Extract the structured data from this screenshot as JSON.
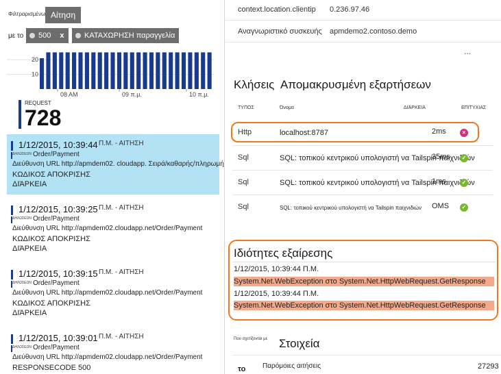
{
  "filter": {
    "label": "Φιλτραρισμένων",
    "type_chip": "Αίτηση",
    "with_label": "με το",
    "chips": [
      {
        "label": "500",
        "close": "x"
      },
      {
        "label": "ΚΑΤΑΧΩΡΗΣΗ παραγγελία"
      }
    ]
  },
  "chart_data": {
    "type": "bar",
    "values": [
      21,
      25,
      25,
      25,
      25,
      25,
      25,
      25,
      25,
      25,
      25,
      25,
      25,
      25,
      25,
      25,
      25,
      25,
      25,
      25,
      25,
      25,
      25,
      25,
      25,
      25,
      25
    ],
    "yticks": [
      "20",
      "10"
    ],
    "ylim": [
      0,
      28
    ],
    "x_tick_labels": [
      "08 AM",
      "09 π.μ.",
      "10 π.μ."
    ],
    "color": "#1a3a8f"
  },
  "request": {
    "label": "REQUEST",
    "count": "728"
  },
  "list": [
    {
      "time": "1/12/2015, 10:39:44",
      "suffix": "Π.Μ. - ΑΙΤΗΣΗ",
      "tiny": "ΔΗΛΩΣΕΩΝ",
      "name": "Order/Payment",
      "url": "Διεύθυνση URL http://apmdem02. cloudapp. Σειρά/καθαρής/πληρωμής",
      "code": "ΚΩΔΙΚΟΣ ΑΠΟΚΡΙΣΗΣ",
      "duration": "ΔΙΆΡΚΕΙΑ",
      "selected": true
    },
    {
      "time": "1/12/2015, 10:39:25",
      "suffix": "Π.Μ. - ΑΙΤΗΣΗ",
      "tiny": "ΔΗΛΩΣΕΩΝ",
      "name": "Order/Payment",
      "url": "Διεύθυνση URL http://apmdem02.cloudapp.net/Order/Payment",
      "code": "ΚΩΔΙΚΟΣ ΑΠΟΚΡΙΣΗΣ",
      "duration": "ΔΙΆΡΚΕΙΑ",
      "selected": false
    },
    {
      "time": "1/12/2015, 10:39:15",
      "suffix": "Π.Μ. - ΑΙΤΗΣΗ",
      "tiny": "ΔΗΛΩΣΕΩΝ",
      "name": "Order/Payment",
      "url": "Διεύθυνση URL http://apmdem02.cloudapp.net/Order/Payment",
      "code": "ΚΩΔΙΚΟΣ ΑΠΟΚΡΙΣΗΣ",
      "duration": "ΔΙΆΡΚΕΙΑ",
      "selected": false
    },
    {
      "time": "1/12/2015, 10:39:01",
      "suffix": "Π.Μ. - ΑΙΤΗΣΗ",
      "tiny": "ΔΗΛΩΣΕΩΝ",
      "name": "Order/Payment",
      "url": "Διεύθυνση URL http://apmdem02.cloudapp.net/Order/Payment",
      "code": "RESPONSECODE 500",
      "duration": "",
      "selected": false
    }
  ],
  "properties": [
    {
      "key": "context.location.clientip",
      "value": "0.236.97.46"
    },
    {
      "key": "Αναγνωριστικό συσκευής",
      "value": "apmdemo2.contoso.demo"
    }
  ],
  "more": "...",
  "dependencies": {
    "title_a": "Κλήσεις",
    "title_b": "Απομακρυσμένη εξαρτήσεων",
    "headers": {
      "type": "ΤΥΠΟΣ",
      "name": "Όνομα",
      "duration": "ΔΙΆΡΚΕΙΑ",
      "success": "ΕΠΙΤΥΧΙΑΣ"
    },
    "rows": [
      {
        "type": "Http",
        "name": "localhost:8787",
        "duration": "2ms",
        "status": "fail",
        "status_glyph": "×"
      },
      {
        "type": "Sql",
        "name": "SQL: τοπικού κεντρικού υπολογιστή να Tailspin παιχνιδιών",
        "duration": "35ms",
        "status": "ok",
        "status_glyph": "✓"
      },
      {
        "type": "Sql",
        "name": "SQL: τοπικού κεντρικού υπολογιστή να Tailspin παιχνιδιών",
        "duration": "1ms",
        "status": "ok",
        "status_glyph": "✓"
      },
      {
        "type": "Sql",
        "name": "SQL: τοπικού κεντρικού υπολογιστή να Tailspin παιχνιδιών",
        "duration": "OMS",
        "status": "ok",
        "status_glyph": "✓"
      }
    ]
  },
  "exceptions": {
    "title": "Ιδιότητες εξαίρεσης",
    "items": [
      {
        "time": "1/12/2015, 10:39:44 Π.Μ.",
        "message": "System.Net.WebException στο System.Net.HttpWebRequest.GetResponse"
      },
      {
        "time": "1/12/2015, 10:39:44 Π.Μ.",
        "message": "System.Net.WebException στο System.Net.HttpWebRequest.GetResponse"
      }
    ]
  },
  "related": {
    "label": "Που σχετίζονται με",
    "title": "Στοιχεία",
    "row_prefix": "το",
    "row_label": "Παρόμοιες αιτήσεις",
    "row_value": "27293"
  }
}
